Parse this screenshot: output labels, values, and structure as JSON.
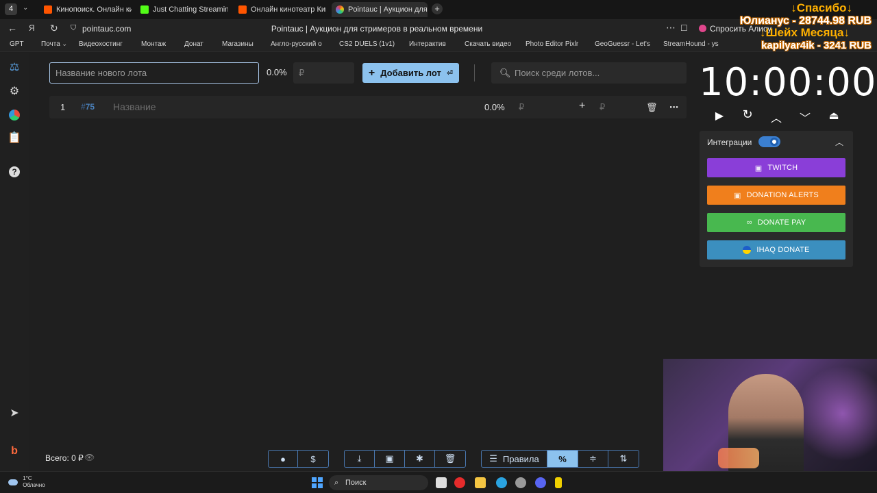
{
  "browser": {
    "tab_count": "4",
    "tabs": [
      {
        "label": "Кинопоиск. Онлайн кино",
        "color": "#ff5500"
      },
      {
        "label": "Just Chatting Streaming - I",
        "color": "#53fc18"
      },
      {
        "label": "Онлайн кинотеатр Кино",
        "color": "#ff5500"
      },
      {
        "label": "Pointauc | Аукцион для",
        "color": "#9b59b6"
      }
    ],
    "url": "pointauc.com",
    "page_title": "Pointauc | Аукцион для стримеров в реальном времени",
    "alice_label": "Спросить Алису",
    "bookmarks": [
      "GPT",
      "Почта",
      "Видеохостинг",
      "Монтаж",
      "Донат",
      "Магазины",
      "Англо-русский о",
      "CS2 DUELS (1v1)",
      "Интерактив",
      "Скачать видео",
      "Photo Editor Pixlr",
      "GeoGuessr - Let's",
      "StreamHound - ys"
    ]
  },
  "overlay": {
    "thanks": "↓Спасибо↓",
    "donor1": "Юлианус - 28744.98 RUB",
    "sheikh": "↓Шейх Месяца↓",
    "donor2": "kapilyar4ik - 3241 RUB"
  },
  "toolbar": {
    "lot_name_placeholder": "Название нового лота",
    "percent": "0.0%",
    "amount_placeholder": "₽",
    "add_lot_label": "Добавить лот",
    "add_lot_enter": "⏎",
    "search_placeholder": "Поиск среди лотов..."
  },
  "lots": [
    {
      "index": "1",
      "id": "75",
      "name_placeholder": "Название",
      "percent": "0.0%",
      "amount_currency": "₽",
      "add_currency": "₽"
    }
  ],
  "timer": {
    "value": "10:00:00"
  },
  "integrations": {
    "title": "Интеграции",
    "enabled": true,
    "buttons": [
      {
        "label": "TWITCH",
        "color": "#8a3ed8"
      },
      {
        "label": "DONATION ALERTS",
        "color": "#f07f1c"
      },
      {
        "label": "DONATE PAY",
        "color": "#48b84f"
      },
      {
        "label": "IHAQ DONATE",
        "color": "#3b8fbf"
      }
    ]
  },
  "footer": {
    "total": "Всего: 0 ₽",
    "rules_label": "Правила"
  },
  "taskbar": {
    "temp": "1°C",
    "weather": "Облачно",
    "search_label": "Поиск"
  }
}
